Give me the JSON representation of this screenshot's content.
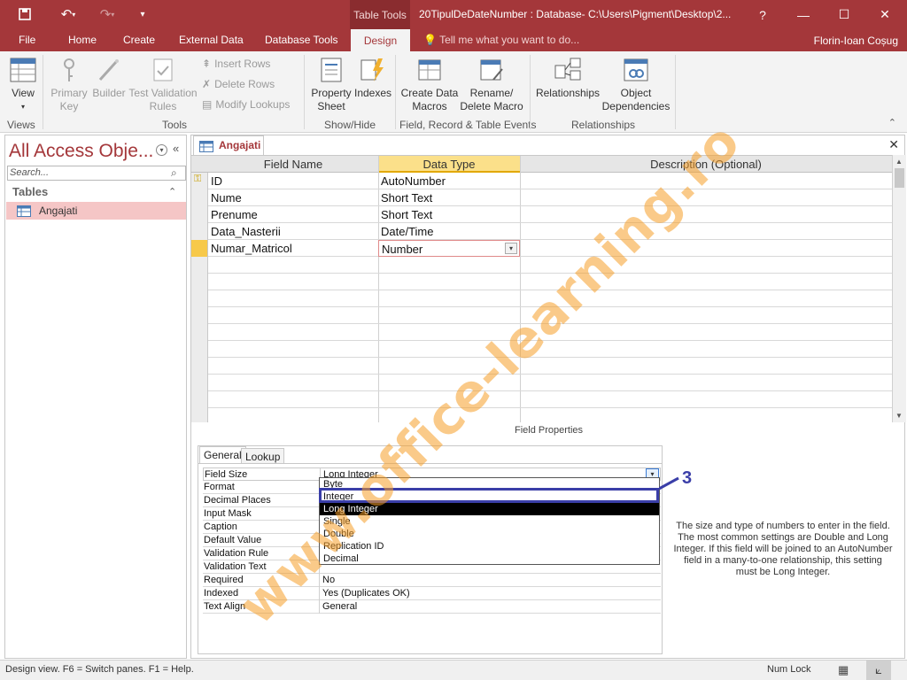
{
  "window": {
    "title": "20TipulDeDateNumber : Database- C:\\Users\\Pigment\\Desktop\\2...",
    "context_tab": "Table Tools",
    "help": "?",
    "user": "Florin-Ioan Coșug"
  },
  "tabs": [
    "File",
    "Home",
    "Create",
    "External Data",
    "Database Tools",
    "Design"
  ],
  "tellme": "Tell me what you want to do...",
  "ribbon": {
    "view": "View",
    "views_group": "Views",
    "primary_key": "Primary Key",
    "builder": "Builder",
    "test_validation": "Test Validation Rules",
    "insert_rows": "Insert Rows",
    "delete_rows": "Delete Rows",
    "modify_lookups": "Modify Lookups",
    "tools_group": "Tools",
    "property_sheet": "Property Sheet",
    "indexes": "Indexes",
    "showhide_group": "Show/Hide",
    "create_macros": "Create Data Macros",
    "rename_delete": "Rename/ Delete Macro",
    "events_group": "Field, Record & Table Events",
    "relationships": "Relationships",
    "object_dependencies": "Object Dependencies",
    "relationships_group": "Relationships"
  },
  "nav": {
    "title": "All Access Obje...",
    "search_placeholder": "Search...",
    "section": "Tables",
    "item": "Angajati"
  },
  "doc": {
    "tab": "Angajati"
  },
  "grid": {
    "headers": [
      "Field Name",
      "Data Type",
      "Description (Optional)"
    ],
    "rows": [
      {
        "name": "ID",
        "type": "AutoNumber"
      },
      {
        "name": "Nume",
        "type": "Short Text"
      },
      {
        "name": "Prenume",
        "type": "Short Text"
      },
      {
        "name": "Data_Nasterii",
        "type": "Date/Time"
      },
      {
        "name": "Numar_Matricol",
        "type": "Number"
      }
    ]
  },
  "field_properties": {
    "label": "Field Properties",
    "tabs": [
      "General",
      "Lookup"
    ],
    "rows": [
      {
        "label": "Field Size",
        "value": "Long Integer"
      },
      {
        "label": "Format",
        "value": ""
      },
      {
        "label": "Decimal Places",
        "value": ""
      },
      {
        "label": "Input Mask",
        "value": ""
      },
      {
        "label": "Caption",
        "value": ""
      },
      {
        "label": "Default Value",
        "value": ""
      },
      {
        "label": "Validation Rule",
        "value": ""
      },
      {
        "label": "Validation Text",
        "value": ""
      },
      {
        "label": "Required",
        "value": "No"
      },
      {
        "label": "Indexed",
        "value": "Yes (Duplicates OK)"
      },
      {
        "label": "Text Align",
        "value": "General"
      }
    ],
    "dropdown": [
      "Byte",
      "Integer",
      "Long Integer",
      "Single",
      "Double",
      "Replication ID",
      "Decimal"
    ],
    "annotation": "3",
    "help": "The size and type of numbers to enter in the field. The most common settings are Double and Long Integer. If this field will be joined to an AutoNumber field in a many-to-one relationship, this setting must be Long Integer."
  },
  "status": {
    "left": "Design view.  F6 = Switch panes.  F1 = Help.",
    "numlock": "Num Lock"
  },
  "watermark": "www.office-learning.ro"
}
